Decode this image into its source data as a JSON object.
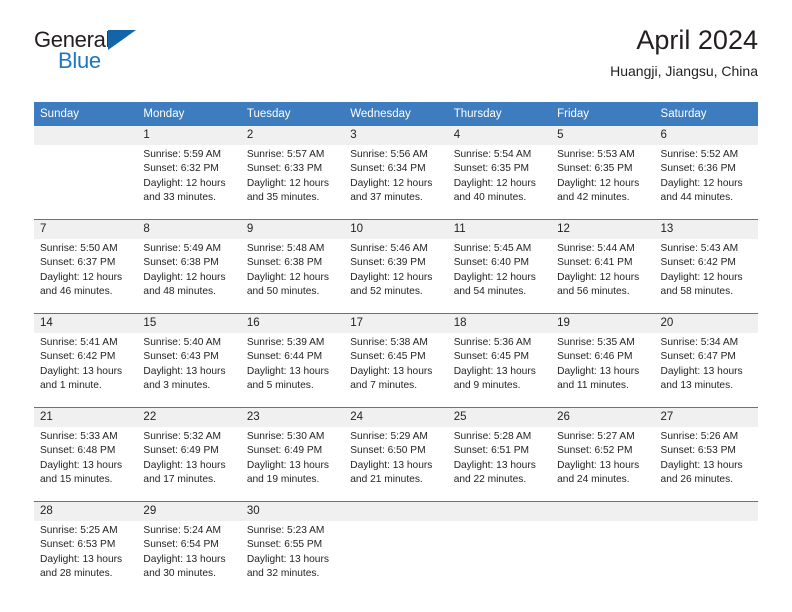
{
  "brand": {
    "name_part1": "General",
    "name_part2": "Blue",
    "accent_color": "#1e77c4",
    "triangle_color": "#1464aa"
  },
  "header": {
    "title": "April 2024",
    "subtitle": "Huangji, Jiangsu, China",
    "header_bg": "#3c7cbf",
    "daynum_bg": "#f0f0f0"
  },
  "weekdays": [
    "Sunday",
    "Monday",
    "Tuesday",
    "Wednesday",
    "Thursday",
    "Friday",
    "Saturday"
  ],
  "weeks": [
    [
      {
        "blank": true,
        "day": "",
        "sunrise": "",
        "sunset": "",
        "daylight1": "",
        "daylight2": ""
      },
      {
        "blank": false,
        "day": "1",
        "sunrise": "Sunrise: 5:59 AM",
        "sunset": "Sunset: 6:32 PM",
        "daylight1": "Daylight: 12 hours",
        "daylight2": "and 33 minutes."
      },
      {
        "blank": false,
        "day": "2",
        "sunrise": "Sunrise: 5:57 AM",
        "sunset": "Sunset: 6:33 PM",
        "daylight1": "Daylight: 12 hours",
        "daylight2": "and 35 minutes."
      },
      {
        "blank": false,
        "day": "3",
        "sunrise": "Sunrise: 5:56 AM",
        "sunset": "Sunset: 6:34 PM",
        "daylight1": "Daylight: 12 hours",
        "daylight2": "and 37 minutes."
      },
      {
        "blank": false,
        "day": "4",
        "sunrise": "Sunrise: 5:54 AM",
        "sunset": "Sunset: 6:35 PM",
        "daylight1": "Daylight: 12 hours",
        "daylight2": "and 40 minutes."
      },
      {
        "blank": false,
        "day": "5",
        "sunrise": "Sunrise: 5:53 AM",
        "sunset": "Sunset: 6:35 PM",
        "daylight1": "Daylight: 12 hours",
        "daylight2": "and 42 minutes."
      },
      {
        "blank": false,
        "day": "6",
        "sunrise": "Sunrise: 5:52 AM",
        "sunset": "Sunset: 6:36 PM",
        "daylight1": "Daylight: 12 hours",
        "daylight2": "and 44 minutes."
      }
    ],
    [
      {
        "blank": false,
        "day": "7",
        "sunrise": "Sunrise: 5:50 AM",
        "sunset": "Sunset: 6:37 PM",
        "daylight1": "Daylight: 12 hours",
        "daylight2": "and 46 minutes."
      },
      {
        "blank": false,
        "day": "8",
        "sunrise": "Sunrise: 5:49 AM",
        "sunset": "Sunset: 6:38 PM",
        "daylight1": "Daylight: 12 hours",
        "daylight2": "and 48 minutes."
      },
      {
        "blank": false,
        "day": "9",
        "sunrise": "Sunrise: 5:48 AM",
        "sunset": "Sunset: 6:38 PM",
        "daylight1": "Daylight: 12 hours",
        "daylight2": "and 50 minutes."
      },
      {
        "blank": false,
        "day": "10",
        "sunrise": "Sunrise: 5:46 AM",
        "sunset": "Sunset: 6:39 PM",
        "daylight1": "Daylight: 12 hours",
        "daylight2": "and 52 minutes."
      },
      {
        "blank": false,
        "day": "11",
        "sunrise": "Sunrise: 5:45 AM",
        "sunset": "Sunset: 6:40 PM",
        "daylight1": "Daylight: 12 hours",
        "daylight2": "and 54 minutes."
      },
      {
        "blank": false,
        "day": "12",
        "sunrise": "Sunrise: 5:44 AM",
        "sunset": "Sunset: 6:41 PM",
        "daylight1": "Daylight: 12 hours",
        "daylight2": "and 56 minutes."
      },
      {
        "blank": false,
        "day": "13",
        "sunrise": "Sunrise: 5:43 AM",
        "sunset": "Sunset: 6:42 PM",
        "daylight1": "Daylight: 12 hours",
        "daylight2": "and 58 minutes."
      }
    ],
    [
      {
        "blank": false,
        "day": "14",
        "sunrise": "Sunrise: 5:41 AM",
        "sunset": "Sunset: 6:42 PM",
        "daylight1": "Daylight: 13 hours",
        "daylight2": "and 1 minute."
      },
      {
        "blank": false,
        "day": "15",
        "sunrise": "Sunrise: 5:40 AM",
        "sunset": "Sunset: 6:43 PM",
        "daylight1": "Daylight: 13 hours",
        "daylight2": "and 3 minutes."
      },
      {
        "blank": false,
        "day": "16",
        "sunrise": "Sunrise: 5:39 AM",
        "sunset": "Sunset: 6:44 PM",
        "daylight1": "Daylight: 13 hours",
        "daylight2": "and 5 minutes."
      },
      {
        "blank": false,
        "day": "17",
        "sunrise": "Sunrise: 5:38 AM",
        "sunset": "Sunset: 6:45 PM",
        "daylight1": "Daylight: 13 hours",
        "daylight2": "and 7 minutes."
      },
      {
        "blank": false,
        "day": "18",
        "sunrise": "Sunrise: 5:36 AM",
        "sunset": "Sunset: 6:45 PM",
        "daylight1": "Daylight: 13 hours",
        "daylight2": "and 9 minutes."
      },
      {
        "blank": false,
        "day": "19",
        "sunrise": "Sunrise: 5:35 AM",
        "sunset": "Sunset: 6:46 PM",
        "daylight1": "Daylight: 13 hours",
        "daylight2": "and 11 minutes."
      },
      {
        "blank": false,
        "day": "20",
        "sunrise": "Sunrise: 5:34 AM",
        "sunset": "Sunset: 6:47 PM",
        "daylight1": "Daylight: 13 hours",
        "daylight2": "and 13 minutes."
      }
    ],
    [
      {
        "blank": false,
        "day": "21",
        "sunrise": "Sunrise: 5:33 AM",
        "sunset": "Sunset: 6:48 PM",
        "daylight1": "Daylight: 13 hours",
        "daylight2": "and 15 minutes."
      },
      {
        "blank": false,
        "day": "22",
        "sunrise": "Sunrise: 5:32 AM",
        "sunset": "Sunset: 6:49 PM",
        "daylight1": "Daylight: 13 hours",
        "daylight2": "and 17 minutes."
      },
      {
        "blank": false,
        "day": "23",
        "sunrise": "Sunrise: 5:30 AM",
        "sunset": "Sunset: 6:49 PM",
        "daylight1": "Daylight: 13 hours",
        "daylight2": "and 19 minutes."
      },
      {
        "blank": false,
        "day": "24",
        "sunrise": "Sunrise: 5:29 AM",
        "sunset": "Sunset: 6:50 PM",
        "daylight1": "Daylight: 13 hours",
        "daylight2": "and 21 minutes."
      },
      {
        "blank": false,
        "day": "25",
        "sunrise": "Sunrise: 5:28 AM",
        "sunset": "Sunset: 6:51 PM",
        "daylight1": "Daylight: 13 hours",
        "daylight2": "and 22 minutes."
      },
      {
        "blank": false,
        "day": "26",
        "sunrise": "Sunrise: 5:27 AM",
        "sunset": "Sunset: 6:52 PM",
        "daylight1": "Daylight: 13 hours",
        "daylight2": "and 24 minutes."
      },
      {
        "blank": false,
        "day": "27",
        "sunrise": "Sunrise: 5:26 AM",
        "sunset": "Sunset: 6:53 PM",
        "daylight1": "Daylight: 13 hours",
        "daylight2": "and 26 minutes."
      }
    ],
    [
      {
        "blank": false,
        "day": "28",
        "sunrise": "Sunrise: 5:25 AM",
        "sunset": "Sunset: 6:53 PM",
        "daylight1": "Daylight: 13 hours",
        "daylight2": "and 28 minutes."
      },
      {
        "blank": false,
        "day": "29",
        "sunrise": "Sunrise: 5:24 AM",
        "sunset": "Sunset: 6:54 PM",
        "daylight1": "Daylight: 13 hours",
        "daylight2": "and 30 minutes."
      },
      {
        "blank": false,
        "day": "30",
        "sunrise": "Sunrise: 5:23 AM",
        "sunset": "Sunset: 6:55 PM",
        "daylight1": "Daylight: 13 hours",
        "daylight2": "and 32 minutes."
      },
      {
        "blank": true,
        "day": "",
        "sunrise": "",
        "sunset": "",
        "daylight1": "",
        "daylight2": ""
      },
      {
        "blank": true,
        "day": "",
        "sunrise": "",
        "sunset": "",
        "daylight1": "",
        "daylight2": ""
      },
      {
        "blank": true,
        "day": "",
        "sunrise": "",
        "sunset": "",
        "daylight1": "",
        "daylight2": ""
      },
      {
        "blank": true,
        "day": "",
        "sunrise": "",
        "sunset": "",
        "daylight1": "",
        "daylight2": ""
      }
    ]
  ]
}
